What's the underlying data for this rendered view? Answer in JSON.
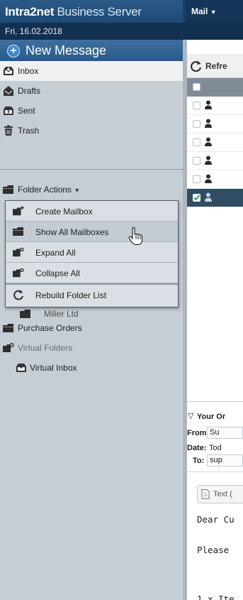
{
  "header": {
    "brand_bold": "Intra2net",
    "brand_rest": " Business Server",
    "menu_label": "Mail",
    "date": "Fri, 16.02.2018"
  },
  "sidebar": {
    "new_message": "New Message",
    "folders": [
      {
        "label": "Inbox",
        "icon": "inbox-icon"
      },
      {
        "label": "Drafts",
        "icon": "drafts-icon"
      },
      {
        "label": "Sent",
        "icon": "sent-icon"
      },
      {
        "label": "Trash",
        "icon": "trash-icon"
      }
    ],
    "folder_actions": "Folder Actions",
    "partial_item": "Miller Ltd",
    "extra": [
      {
        "label": "Purchase Orders",
        "icon": "folder-icon"
      },
      {
        "label": "Virtual Folders",
        "icon": "virtual-folders-icon"
      },
      {
        "label": "Virtual Inbox",
        "icon": "virtual-inbox-icon"
      }
    ]
  },
  "context_menu": {
    "items": [
      {
        "label": "Create Mailbox",
        "icon": "create-mailbox-icon"
      },
      {
        "label": "Show All Mailboxes",
        "icon": "folder-icon"
      },
      {
        "label": "Expand All",
        "icon": "expand-icon"
      },
      {
        "label": "Collapse All",
        "icon": "collapse-icon"
      },
      {
        "label": "Rebuild Folder List",
        "icon": "refresh-icon"
      }
    ]
  },
  "message_list": {
    "refresh_label": "Refre",
    "row_count": 6,
    "selected_row": 6
  },
  "preview": {
    "subject": "Your Or",
    "from_label": "From:",
    "from_value": "Su",
    "date_label": "Date:",
    "date_value": "Tod",
    "to_label": "To:",
    "to_value": "sup",
    "text_tab": "Text (",
    "body": [
      "Dear Cu",
      "Please",
      "1 x Ite"
    ]
  },
  "colors": {
    "header": "#1b3f63",
    "sidebar": "#c6ced5",
    "selected_row": "#2f4d63"
  }
}
